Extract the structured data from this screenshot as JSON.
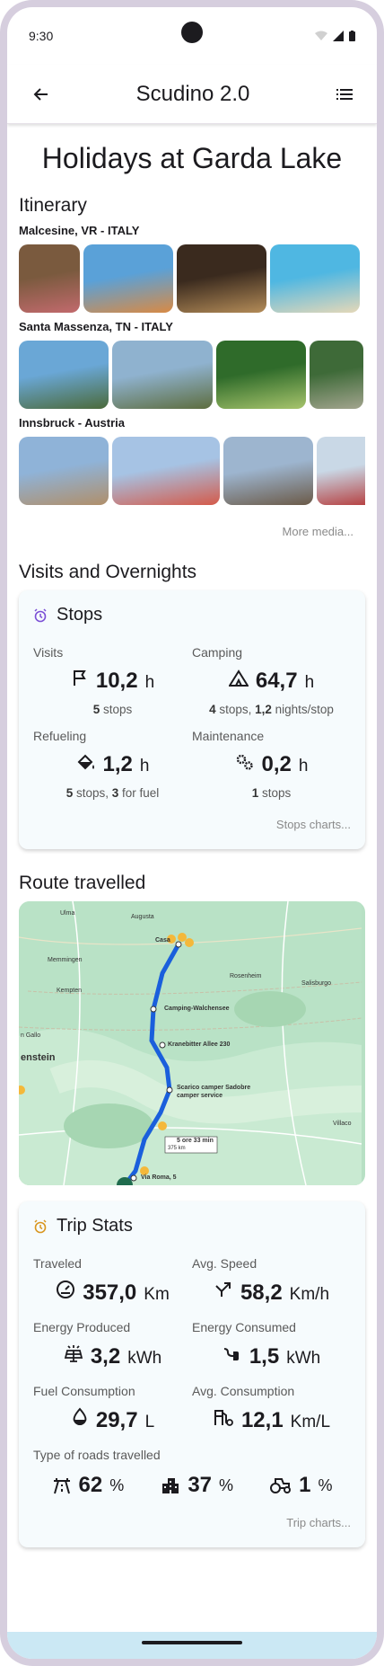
{
  "status": {
    "time": "9:30"
  },
  "appbar": {
    "title": "Scudino 2.0"
  },
  "page": {
    "title": "Holidays at Garda Lake"
  },
  "itinerary": {
    "title": "Itinerary",
    "places": [
      {
        "name": "Malcesine, VR - ITALY",
        "thumbs": [
          {
            "w": 68,
            "c1": "#7a5a3e",
            "c2": "#c26a6d"
          },
          {
            "w": 100,
            "c1": "#5aa1d8",
            "c2": "#d98a44"
          },
          {
            "w": 100,
            "c1": "#3a2a1e",
            "c2": "#b48c58"
          },
          {
            "w": 100,
            "c1": "#4fb7e2",
            "c2": "#e6d8b8"
          }
        ]
      },
      {
        "name": "Santa Massenza, TN - ITALY",
        "thumbs": [
          {
            "w": 100,
            "c1": "#6aa7d6",
            "c2": "#4b6a3a"
          },
          {
            "w": 112,
            "c1": "#8fb2cf",
            "c2": "#5d6d3e"
          },
          {
            "w": 100,
            "c1": "#2f6b2a",
            "c2": "#a7c46c"
          },
          {
            "w": 60,
            "c1": "#3e6a38",
            "c2": "#a2a48e"
          }
        ]
      },
      {
        "name": "Innsbruck - Austria",
        "thumbs": [
          {
            "w": 100,
            "c1": "#8fb3d8",
            "c2": "#b08f6a"
          },
          {
            "w": 120,
            "c1": "#a6c3e4",
            "c2": "#d45a4a"
          },
          {
            "w": 100,
            "c1": "#9db5cf",
            "c2": "#6b5a48"
          },
          {
            "w": 70,
            "c1": "#c9d8e6",
            "c2": "#b53a3a"
          }
        ]
      }
    ],
    "more": "More media..."
  },
  "visits": {
    "title": "Visits and Overnights",
    "card_title": "Stops",
    "cells": [
      {
        "label": "Visits",
        "value": "10,2",
        "unit": "h",
        "icon": "flag-icon",
        "sub": [
          {
            "b": "5"
          },
          {
            "t": " stops"
          }
        ]
      },
      {
        "label": "Camping",
        "value": "64,7",
        "unit": "h",
        "icon": "tent-icon",
        "sub": [
          {
            "b": "4"
          },
          {
            "t": " stops, "
          },
          {
            "b": "1,2"
          },
          {
            "t": " nights/stop"
          }
        ]
      },
      {
        "label": "Refueling",
        "value": "1,2",
        "unit": "h",
        "icon": "fuel-can-icon",
        "sub": [
          {
            "b": "5"
          },
          {
            "t": " stops, "
          },
          {
            "b": "3"
          },
          {
            "t": " for fuel"
          }
        ]
      },
      {
        "label": "Maintenance",
        "value": "0,2",
        "unit": "h",
        "icon": "gears-icon",
        "sub": [
          {
            "b": "1"
          },
          {
            "t": " stops"
          }
        ]
      }
    ],
    "link": "Stops charts..."
  },
  "route": {
    "title": "Route travelled",
    "labels": {
      "ulma": "Ulma",
      "augusta": "Augusta",
      "casa": "Casa",
      "memmingen": "Memmingen",
      "rosenheim": "Rosenheim",
      "salisburgo": "Salisburgo",
      "kempten": "Kempten",
      "camping": "Camping-Walchensee",
      "gallo": "n Gallo",
      "kranebitter": "Kranebitter Allee 230",
      "enstein": "enstein",
      "scarico": "Scarico camper Sadobre",
      "scarico2": "camper service",
      "villaco": "Villaco",
      "duration": "5 ore 33 min",
      "distance": "375 km",
      "viaroma": "Via Roma, 5"
    }
  },
  "trip": {
    "card_title": "Trip Stats",
    "cells": [
      {
        "label": "Traveled",
        "value": "357,0",
        "unit": "Km",
        "icon": "speedometer-icon"
      },
      {
        "label": "Avg. Speed",
        "value": "58,2",
        "unit": "Km/h",
        "icon": "trend-arrow-icon"
      },
      {
        "label": "Energy Produced",
        "value": "3,2",
        "unit": "kWh",
        "icon": "solar-panel-icon"
      },
      {
        "label": "Energy Consumed",
        "value": "1,5",
        "unit": "kWh",
        "icon": "plug-icon"
      },
      {
        "label": "Fuel Consumption",
        "value": "29,7",
        "unit": "L",
        "icon": "drop-icon"
      },
      {
        "label": "Avg. Consumption",
        "value": "12,1",
        "unit": "Km/L",
        "icon": "gas-pump-icon"
      }
    ],
    "roads_label": "Type of roads travelled",
    "roads": [
      {
        "value": "62",
        "unit": "%",
        "icon": "highway-icon"
      },
      {
        "value": "37",
        "unit": "%",
        "icon": "city-icon"
      },
      {
        "value": "1",
        "unit": "%",
        "icon": "tractor-icon"
      }
    ],
    "link": "Trip charts..."
  },
  "colors": {
    "accent_purple": "#7b4fd6",
    "accent_orange": "#d9961f",
    "card_bg": "#f6fbfd",
    "route_blue": "#1a5fdc"
  }
}
